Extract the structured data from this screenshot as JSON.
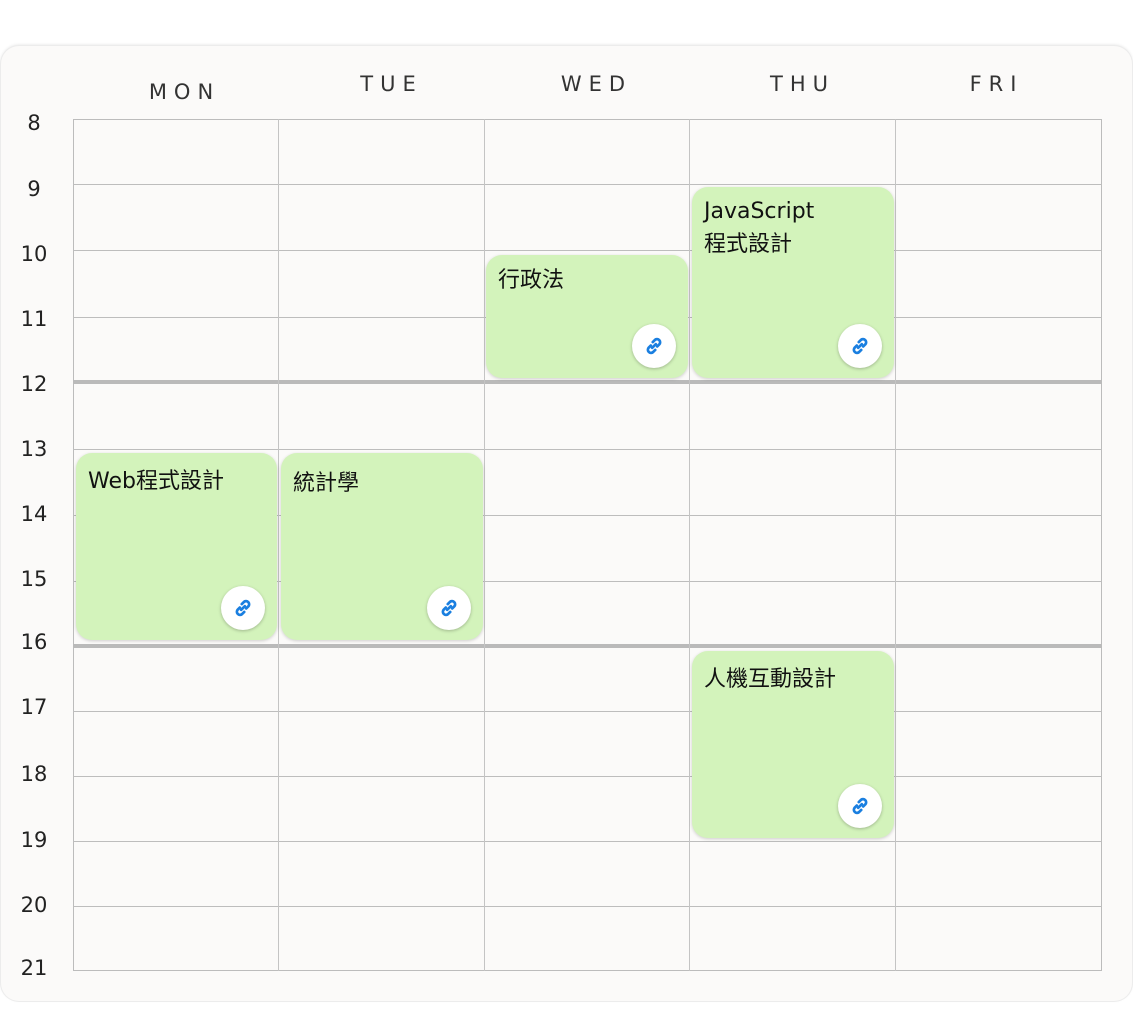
{
  "days": [
    "MON",
    "TUE",
    "WED",
    "THU",
    "FRI"
  ],
  "hours": [
    "8",
    "9",
    "10",
    "11",
    "12",
    "13",
    "14",
    "15",
    "16",
    "17",
    "18",
    "19",
    "20",
    "21"
  ],
  "courses": [
    {
      "name": "JavaScript\n程式設計",
      "day": "THU",
      "start": 9,
      "end": 12
    },
    {
      "name": "行政法",
      "day": "WED",
      "start": 10,
      "end": 12
    },
    {
      "name": "Web程式設計",
      "day": "MON",
      "start": 13,
      "end": 16
    },
    {
      "name": "統計學",
      "day": "TUE",
      "start": 13,
      "end": 16
    },
    {
      "name": "人機互動設計",
      "day": "THU",
      "start": 16,
      "end": 19
    }
  ],
  "icons": {
    "course_link": "link-icon"
  },
  "colors": {
    "course_bg": "#d3f3bb",
    "link_icon": "#1a7fe0"
  }
}
